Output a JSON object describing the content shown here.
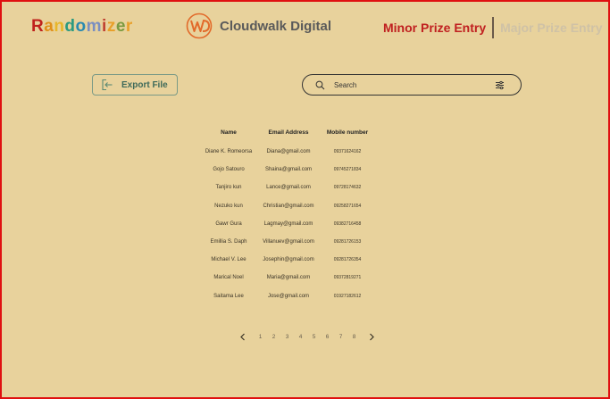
{
  "header": {
    "logo_letters": [
      "R",
      "a",
      "n",
      "d",
      "o",
      "m",
      "i",
      "z",
      "e",
      "r"
    ],
    "logo_colors": [
      "#c0221d",
      "#e0901a",
      "#e8b62a",
      "#2a9a80",
      "#2a8ab0",
      "#7a8fc0",
      "#c04030",
      "#e8a02a",
      "#7a9a40",
      "#e8a02a"
    ],
    "brand_name": "Cloudwalk Digital",
    "tab_minor": "Minor Prize Entry",
    "tab_major": "Major Prize Entry"
  },
  "toolbar": {
    "export_label": "Export File",
    "search_placeholder": "Search"
  },
  "table": {
    "headers": [
      "Name",
      "Email Address",
      "Mobile number"
    ],
    "rows": [
      {
        "name": "Diane K. Romeorsa",
        "email": "Diana@gmail.com",
        "mobile": "09371624162"
      },
      {
        "name": "Gojo Satouro",
        "email": "Shaina@gmail.com",
        "mobile": "09745271834"
      },
      {
        "name": "Tanjiro kun",
        "email": "Lance@gmail.com",
        "mobile": "09728174632"
      },
      {
        "name": "Nezuko kun",
        "email": "Christian@gmail.com",
        "mobile": "09258271654"
      },
      {
        "name": "Gawr Gura",
        "email": "Lagmay@gmail.com",
        "mobile": "09382716458"
      },
      {
        "name": "Emillia S. Daph",
        "email": "Villanuev@gmail.com",
        "mobile": "09281726153"
      },
      {
        "name": "Michael V. Lee",
        "email": "Josephin@gmail.com",
        "mobile": "09281726354"
      },
      {
        "name": "Marical Noel",
        "email": "Maria@gmail.com",
        "mobile": "09372819271"
      },
      {
        "name": "Saitama Lee",
        "email": "Jose@gmail.com",
        "mobile": "01927182612"
      }
    ]
  },
  "pagination": {
    "pages": [
      "1",
      "2",
      "3",
      "4",
      "5",
      "6",
      "7",
      "8"
    ]
  },
  "colors": {
    "background": "#e8d29c",
    "border": "#e01010",
    "accent_red": "#c02020",
    "export_green": "#3e6a5a"
  }
}
